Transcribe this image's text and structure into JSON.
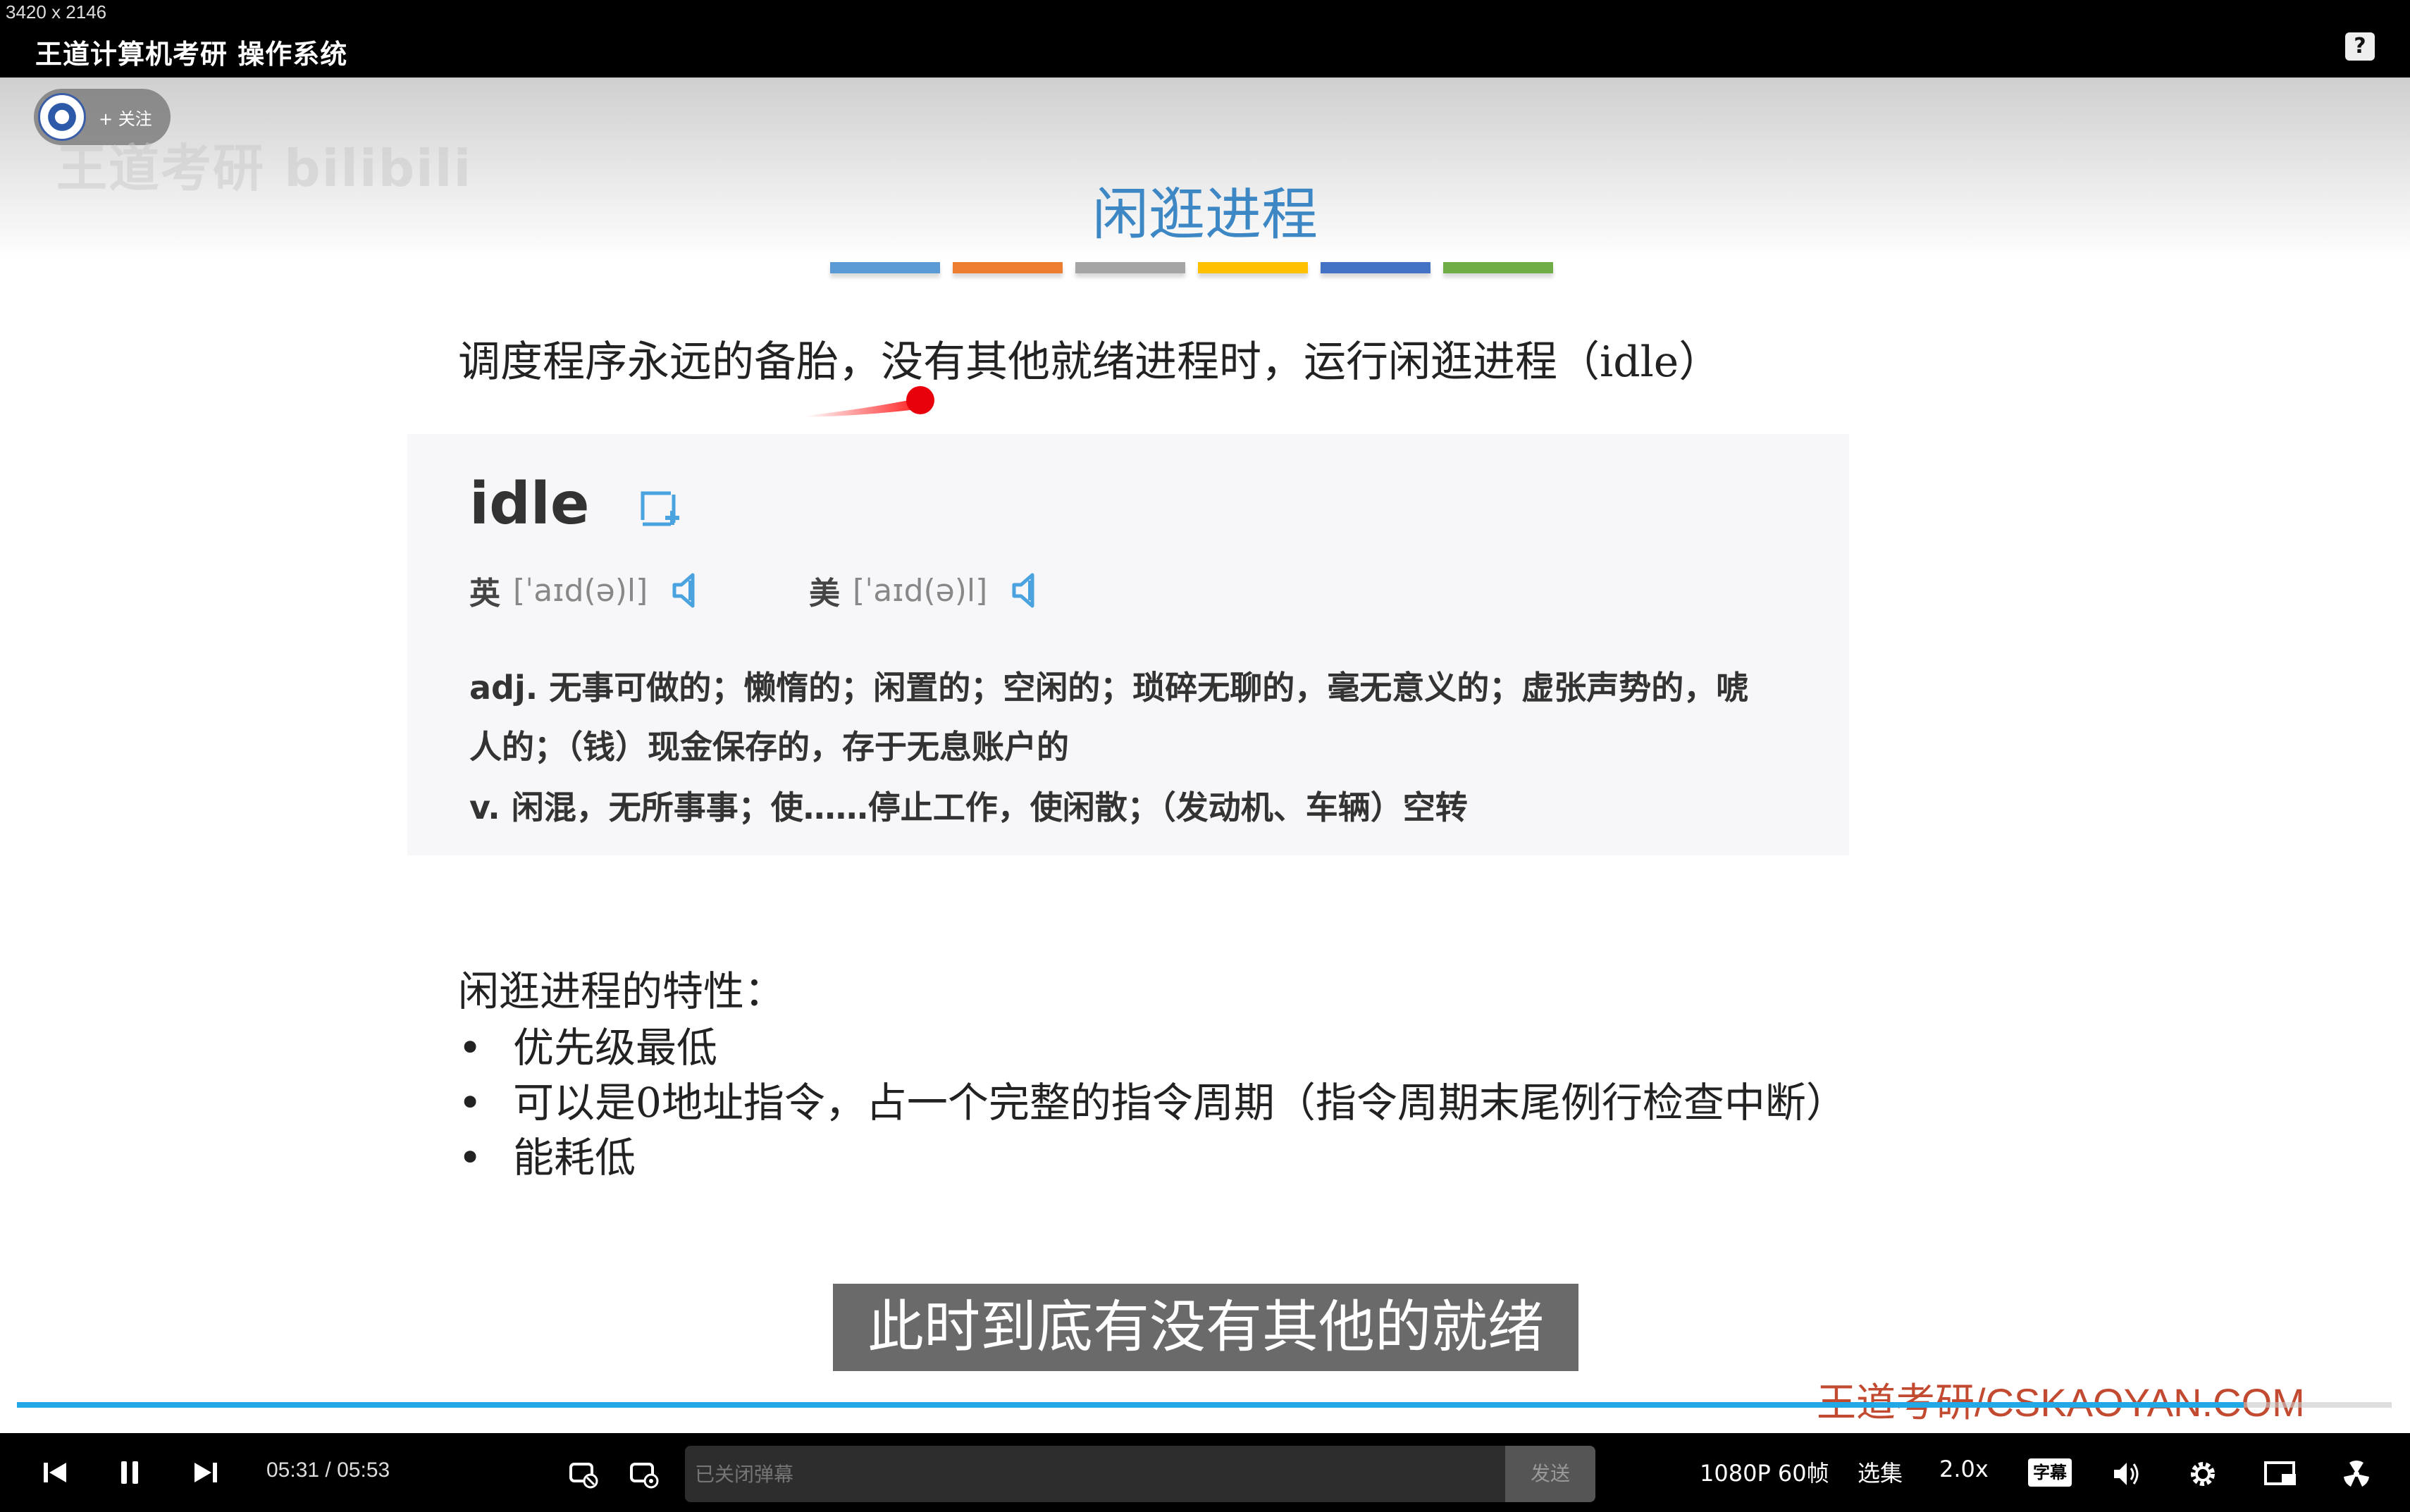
{
  "window": {
    "dimensions_label": "3420 x 2146",
    "title": "王道计算机考研 操作系统",
    "help_label": "?"
  },
  "overlay": {
    "follow_label": "+ 关注",
    "watermark_logo": "王道考研 bilibili"
  },
  "slide": {
    "title": "闲逛进程",
    "bar_colors": [
      "#5b9bd5",
      "#ed7d31",
      "#a5a5a5",
      "#ffc000",
      "#4472c4",
      "#70ad47"
    ],
    "intro": "调度程序永远的备胎，没有其他就绪进程时，运行闲逛进程（idle）",
    "dictionary": {
      "word": "idle",
      "uk_label": "英",
      "uk_phonetic": "[ˈaɪd(ə)l]",
      "us_label": "美",
      "us_phonetic": "[ˈaɪd(ə)l]",
      "def_line1": "adj. 无事可做的；懒惰的；闲置的；空闲的；琐碎无聊的，毫无意义的；虚张声势的，唬",
      "def_line2": "人的；（钱）现金保存的，存于无息账户的",
      "def_line3": "v. 闲混，无所事事；使……停止工作，使闲散；（发动机、车辆）空转"
    },
    "properties_title": "闲逛进程的特性：",
    "properties": [
      "优先级最低",
      "可以是0地址指令，占一个完整的指令周期（指令周期末尾例行检查中断）",
      "能耗低"
    ],
    "bullet_char": "•"
  },
  "subtitle": "此时到底有没有其他的就绪",
  "brand_watermark": "王道考研/CSKAOYAN.COM",
  "player": {
    "progress": 0.9376,
    "current_time": "05:31",
    "separator": "/",
    "total_time": "05:53",
    "danmaku_placeholder": "已关闭弹幕",
    "send_label": "发送",
    "quality": "1080P 60帧",
    "episodes": "选集",
    "speed": "2.0x",
    "subtitle_badge": "字幕",
    "accent_color": "#23a8e6"
  }
}
